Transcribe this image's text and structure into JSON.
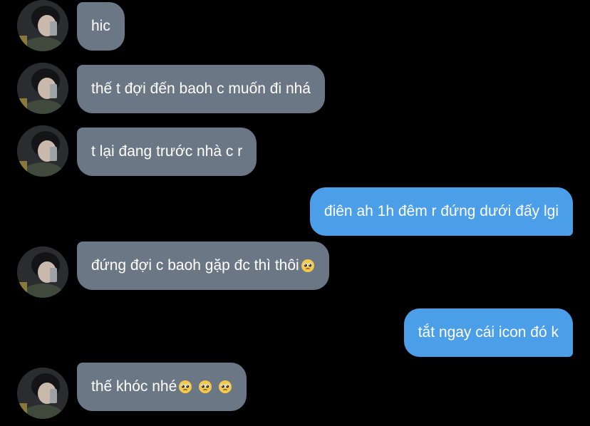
{
  "messages": [
    {
      "side": "in",
      "text": "hic"
    },
    {
      "side": "in",
      "text": "thế t đợi đến baoh c muốn đi nhá"
    },
    {
      "side": "in",
      "text": "t lại đang trước nhà c r"
    },
    {
      "side": "out",
      "text": "điên ah 1h đêm r đứng dưới đấy lgi"
    },
    {
      "side": "in",
      "text": "đứng đợi c baoh gặp đc thì thôi",
      "emojis": [
        "pleading-face-icon"
      ]
    },
    {
      "side": "out",
      "text": "tắt ngay cái icon đó k"
    },
    {
      "side": "in",
      "text": "thế khóc nhé",
      "emojis": [
        "pleading-face-icon",
        "pleading-face-icon",
        "pleading-face-icon"
      ]
    }
  ],
  "colors": {
    "background": "#000000",
    "incoming_bubble": "#6c7785",
    "outgoing_bubble": "#4b9ee8",
    "text": "#ffffff"
  }
}
